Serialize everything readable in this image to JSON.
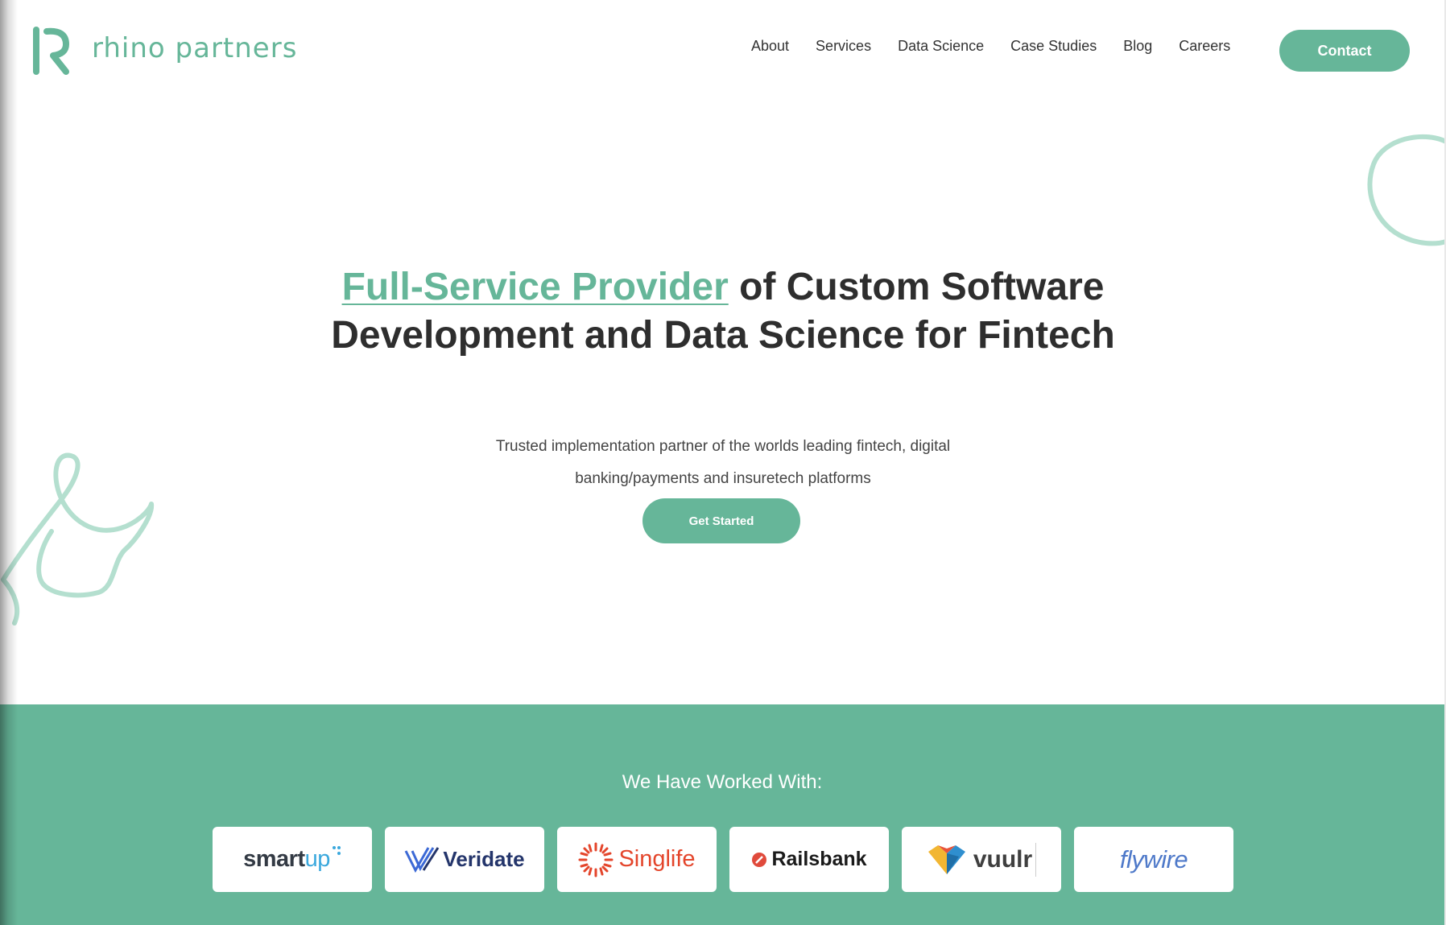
{
  "brand": {
    "name": "rhino partners",
    "accent_color": "#66b699"
  },
  "nav": {
    "items": [
      {
        "label": "About"
      },
      {
        "label": "Services"
      },
      {
        "label": "Data Science"
      },
      {
        "label": "Case Studies"
      },
      {
        "label": "Blog"
      },
      {
        "label": "Careers"
      }
    ],
    "contact_label": "Contact"
  },
  "hero": {
    "title_highlight": "Full-Service Provider",
    "title_rest": " of Custom Software Development and Data Science for Fintech",
    "subtitle": "Trusted implementation partner of the worlds leading fintech, digital banking/payments and insuretech platforms",
    "cta_label": "Get Started"
  },
  "partners": {
    "heading": "We Have Worked With:",
    "band_color": "#66b699",
    "logos": [
      {
        "name": "smart",
        "suffix": "up"
      },
      {
        "name": "Veridate"
      },
      {
        "name": "Singlife"
      },
      {
        "name": "Railsbank"
      },
      {
        "name": "vuulr"
      },
      {
        "name": "flywire"
      }
    ]
  },
  "icons": {
    "logo_mark": "rhino-r-logo-icon",
    "decorations": [
      "squiggle-circle-icon",
      "squiggle-loop-icon"
    ]
  }
}
